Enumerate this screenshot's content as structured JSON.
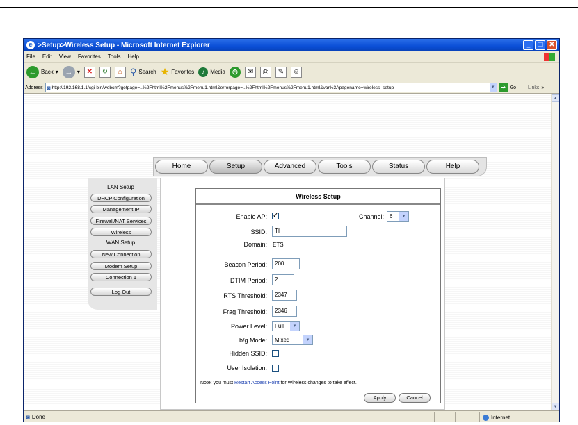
{
  "window": {
    "title": ">Setup>Wireless Setup - Microsoft Internet Explorer",
    "ie_icon": "e",
    "controls": {
      "minimize": "_",
      "maximize": "□",
      "close": "✕"
    }
  },
  "menubar": [
    "File",
    "Edit",
    "View",
    "Favorites",
    "Tools",
    "Help"
  ],
  "toolbar": {
    "back_label": "Back",
    "search_label": "Search",
    "favorites_label": "Favorites",
    "media_label": "Media"
  },
  "address": {
    "label": "Address",
    "url": "http://192.168.1.1/cgi-bin/webcm?getpage=..%2Fhtml%2Fmenus%2Fmenu1.html&errorpage=..%2Fhtml%2Fmenus%2Fmenu1.html&var%3Apagename=wireless_setup",
    "go_label": "Go",
    "links_label": "Links"
  },
  "nav": {
    "tabs": [
      "Home",
      "Setup",
      "Advanced",
      "Tools",
      "Status",
      "Help"
    ],
    "active_tab": "Setup"
  },
  "sidebar": {
    "items": [
      {
        "label": "LAN Setup",
        "kind": "header"
      },
      {
        "label": "DHCP Configuration",
        "kind": "button"
      },
      {
        "label": "Management IP",
        "kind": "button"
      },
      {
        "label": "Firewall/NAT Services",
        "kind": "button"
      },
      {
        "label": "Wireless",
        "kind": "button"
      },
      {
        "label": "WAN Setup",
        "kind": "header"
      },
      {
        "label": "New Connection",
        "kind": "button"
      },
      {
        "label": "Modem Setup",
        "kind": "button"
      },
      {
        "label": "Connection 1",
        "kind": "button"
      },
      {
        "label": "Log Out",
        "kind": "button"
      }
    ]
  },
  "form": {
    "title": "Wireless Setup",
    "enable_ap_label": "Enable AP:",
    "enable_ap_checked": true,
    "channel_label": "Channel:",
    "channel_value": "6",
    "ssid_label": "SSID:",
    "ssid_value": "TI",
    "domain_label": "Domain:",
    "domain_value": "ETSI",
    "beacon_label": "Beacon Period:",
    "beacon_value": "200",
    "dtim_label": "DTIM Period:",
    "dtim_value": "2",
    "rts_label": "RTS Threshold:",
    "rts_value": "2347",
    "frag_label": "Frag Threshold:",
    "frag_value": "2346",
    "power_label": "Power Level:",
    "power_value": "Full",
    "bg_mode_label": "b/g Mode:",
    "bg_mode_value": "Mixed",
    "hidden_ssid_label": "Hidden SSID:",
    "hidden_ssid_checked": false,
    "user_isolation_label": "User Isolation:",
    "user_isolation_checked": false,
    "note_prefix": "Note: you must ",
    "note_link": "Restart Access Point",
    "note_suffix": " for Wireless changes to take effect.",
    "apply_label": "Apply",
    "cancel_label": "Cancel"
  },
  "status": {
    "left_text": "Done",
    "zone_text": "Internet"
  }
}
